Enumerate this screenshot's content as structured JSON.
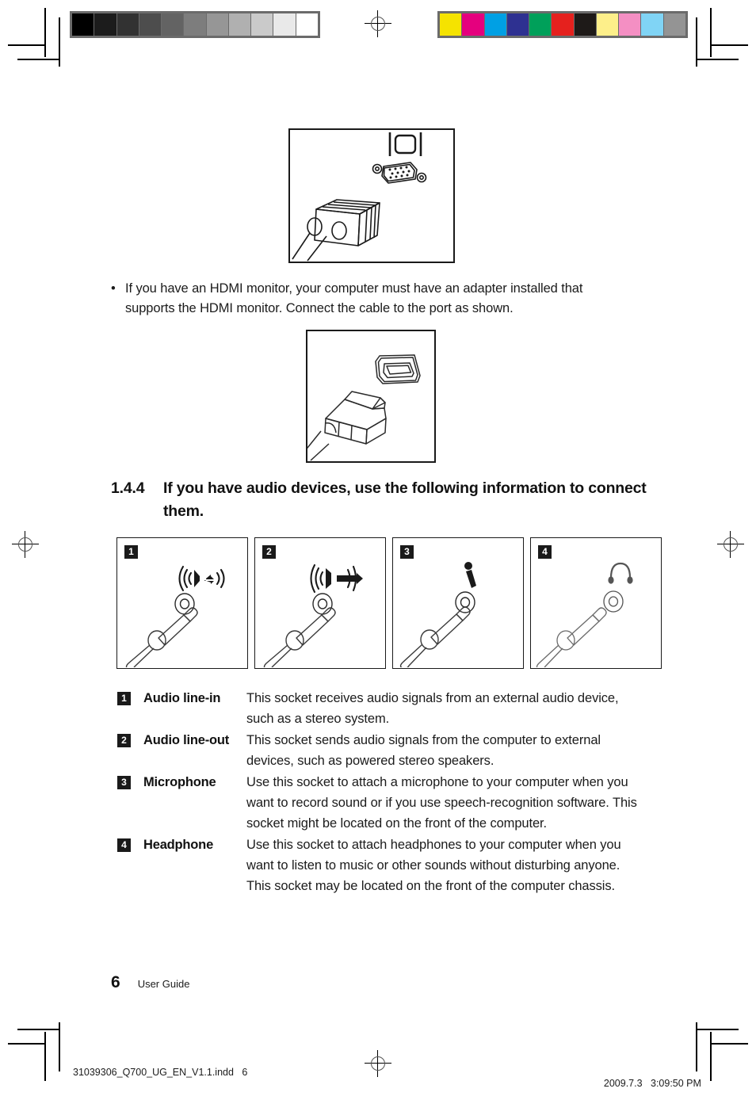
{
  "document": {
    "page_number": "6",
    "footer_label": "User Guide",
    "print_filename": "31039306_Q700_UG_EN_V1.1.indd   6",
    "print_date": "2009.7.3",
    "print_time": "3:09:50 PM"
  },
  "prepress": {
    "grayscale_bar": [
      "#000000",
      "#1c1c1c",
      "#323232",
      "#4d4d4d",
      "#636363",
      "#7d7d7d",
      "#969696",
      "#b0b0b0",
      "#cacaca",
      "#e9e9e9",
      "#ffffff"
    ],
    "color_bar": [
      "#f5e300",
      "#e5007e",
      "#00a0e4",
      "#2e3191",
      "#00a05a",
      "#e5211e",
      "#1e1a18",
      "#fdef8a",
      "#f48fc3",
      "#80d4f5",
      "#949494"
    ],
    "bar_border": "#6b6b6b"
  },
  "figures": {
    "vga": {
      "name": "VGA monitor connector illustration",
      "icon_label": "monitor-icon"
    },
    "hdmi": {
      "name": "HDMI connector illustration"
    }
  },
  "bullet": {
    "marker": "•",
    "text": "If you have an HDMI monitor, your computer must have an adapter installed that supports the HDMI monitor. Connect the cable to the port as shown."
  },
  "section": {
    "number": "1.4.4",
    "title": "If you have audio devices, use the following information to connect them."
  },
  "jack_panels": [
    {
      "badge": "1",
      "icon": "audio-line-in-icon"
    },
    {
      "badge": "2",
      "icon": "audio-line-out-icon"
    },
    {
      "badge": "3",
      "icon": "microphone-icon"
    },
    {
      "badge": "4",
      "icon": "headphone-icon"
    }
  ],
  "definitions": [
    {
      "badge": "1",
      "term": "Audio line-in",
      "description": "This socket receives audio signals from an external audio device, such as a stereo system."
    },
    {
      "badge": "2",
      "term": "Audio line-out",
      "description": "This socket sends audio signals from the computer to external devices, such as powered stereo speakers."
    },
    {
      "badge": "3",
      "term": "Microphone",
      "description": "Use this socket to attach a microphone to your computer when you want to record sound or if you use speech-recognition software. This socket might be located on the front of the computer."
    },
    {
      "badge": "4",
      "term": "Headphone",
      "description": "Use this socket to attach headphones to your computer when you want to listen to music or other sounds without disturbing anyone. This socket may be located on the front of the computer chassis."
    }
  ]
}
